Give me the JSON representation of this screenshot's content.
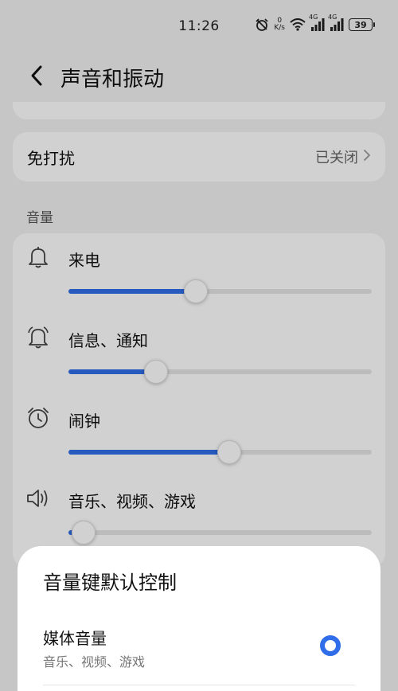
{
  "status_bar": {
    "time": "11:26",
    "net_speed_value": "0",
    "net_speed_unit": "K/s",
    "signal1_label": "4G",
    "signal2_label": "4G",
    "battery": "39"
  },
  "header": {
    "title": "声音和振动"
  },
  "dnd": {
    "label": "免打扰",
    "value": "已关闭"
  },
  "volume": {
    "section_title": "音量",
    "items": [
      {
        "label": "来电",
        "level": 0.42
      },
      {
        "label": "信息、通知",
        "level": 0.29
      },
      {
        "label": "闹钟",
        "level": 0.53
      },
      {
        "label": "音乐、视频、游戏",
        "level": 0.05
      }
    ]
  },
  "sheet": {
    "title": "音量键默认控制",
    "option_title": "媒体音量",
    "option_subtitle": "音乐、视频、游戏"
  },
  "colors": {
    "accent": "#2f6ee8",
    "background": "#f2f2f2",
    "card": "#ffffff"
  }
}
